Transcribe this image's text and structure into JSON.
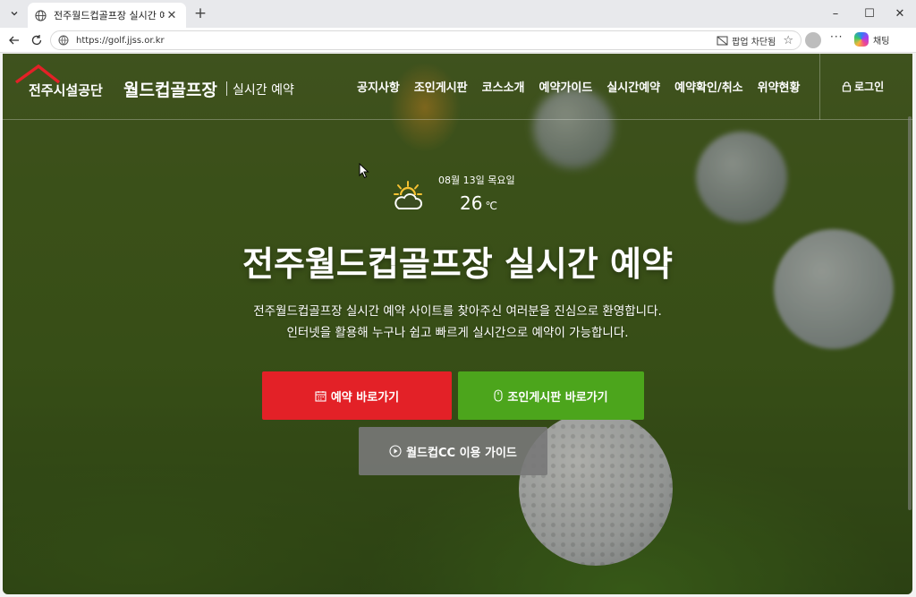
{
  "browser": {
    "tab_title": "전주월드컵골프장 실시간 예약",
    "tab_close": "✕",
    "new_tab": "+",
    "url": "https://golf.jjss.or.kr",
    "popup_blocked": "팝업 차단됨",
    "copilot_label": "채팅",
    "more": "···",
    "window": {
      "minimize": "–",
      "maximize": "☐",
      "close": "✕"
    }
  },
  "header": {
    "org_name": "전주시설공단",
    "club_name": "월드컵골프장",
    "subtitle": "실시간 예약",
    "nav": [
      "공지사항",
      "조인게시판",
      "코스소개",
      "예약가이드",
      "실시간예약",
      "예약확인/취소",
      "위약현황"
    ],
    "login": "로그인"
  },
  "weather": {
    "date": "08월 13일 목요일",
    "temp": "26",
    "unit": "℃",
    "icon": "partly-cloudy-icon"
  },
  "hero": {
    "title": "전주월드컵골프장 실시간 예약",
    "desc_line1": "전주월드컵골프장 실시간 예약 사이트를 찾아주신 여러분을 진심으로 환영합니다.",
    "desc_line2": "인터넷을 활용해 누구나 쉽고 빠르게 실시간으로 예약이 가능합니다."
  },
  "buttons": {
    "reserve": "예약 바로가기",
    "join": "조인게시판 바로가기",
    "guide": "월드컵CC 이용 가이드"
  },
  "colors": {
    "reserve": "#e32127",
    "join": "#4ca51c",
    "guide": "#787878",
    "logo_red": "#e32127"
  }
}
